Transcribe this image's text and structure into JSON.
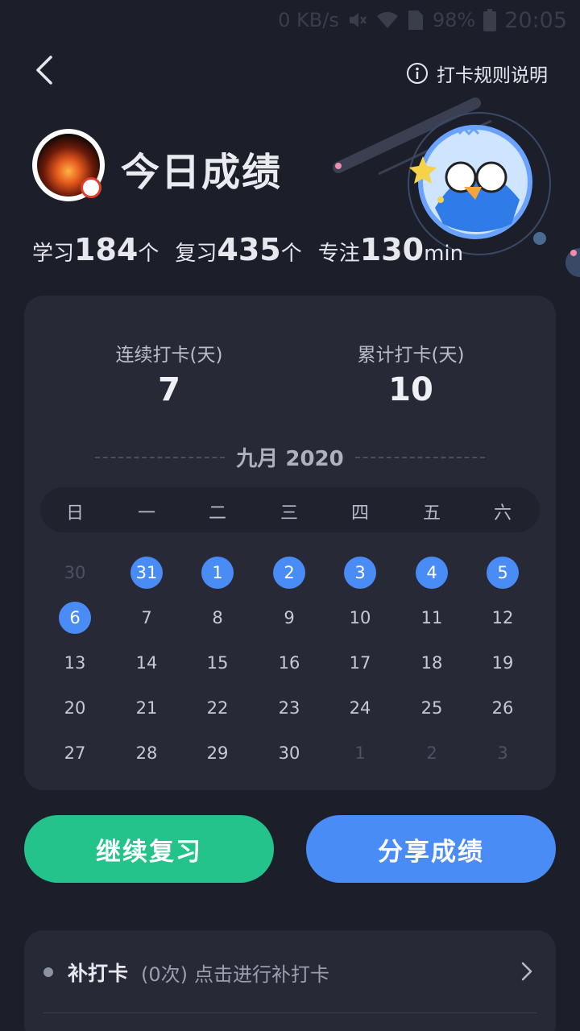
{
  "status_bar": {
    "network_speed": "0 KB/s",
    "battery": "98%",
    "time": "20:05",
    "icons": [
      "mute-icon",
      "wifi-icon",
      "sim-icon",
      "battery-icon"
    ]
  },
  "header": {
    "back_icon": "chevron-left-icon",
    "rules_label": "打卡规则说明",
    "rules_icon": "info-icon"
  },
  "profile": {
    "title": "今日成绩",
    "stats": [
      {
        "label": "学习",
        "value": "184",
        "unit": "个"
      },
      {
        "label": "复习",
        "value": "435",
        "unit": "个"
      },
      {
        "label": "专注",
        "value": "130",
        "unit": "min"
      }
    ]
  },
  "calendar_card": {
    "streak": {
      "label": "连续打卡(天)",
      "value": "7"
    },
    "total": {
      "label": "累计打卡(天)",
      "value": "10"
    },
    "month_label": "九月 2020",
    "weekdays": [
      "日",
      "一",
      "二",
      "三",
      "四",
      "五",
      "六"
    ],
    "weeks": [
      [
        {
          "d": "30",
          "s": "muted"
        },
        {
          "d": "31",
          "s": "checked"
        },
        {
          "d": "1",
          "s": "checked"
        },
        {
          "d": "2",
          "s": "checked"
        },
        {
          "d": "3",
          "s": "checked"
        },
        {
          "d": "4",
          "s": "checked"
        },
        {
          "d": "5",
          "s": "checked"
        }
      ],
      [
        {
          "d": "6",
          "s": "checked"
        },
        {
          "d": "7",
          "s": "normal"
        },
        {
          "d": "8",
          "s": "normal"
        },
        {
          "d": "9",
          "s": "normal"
        },
        {
          "d": "10",
          "s": "normal"
        },
        {
          "d": "11",
          "s": "normal"
        },
        {
          "d": "12",
          "s": "normal"
        }
      ],
      [
        {
          "d": "13",
          "s": "normal"
        },
        {
          "d": "14",
          "s": "normal"
        },
        {
          "d": "15",
          "s": "normal"
        },
        {
          "d": "16",
          "s": "normal"
        },
        {
          "d": "17",
          "s": "normal"
        },
        {
          "d": "18",
          "s": "normal"
        },
        {
          "d": "19",
          "s": "normal"
        }
      ],
      [
        {
          "d": "20",
          "s": "normal"
        },
        {
          "d": "21",
          "s": "normal"
        },
        {
          "d": "22",
          "s": "normal"
        },
        {
          "d": "23",
          "s": "normal"
        },
        {
          "d": "24",
          "s": "normal"
        },
        {
          "d": "25",
          "s": "normal"
        },
        {
          "d": "26",
          "s": "normal"
        }
      ],
      [
        {
          "d": "27",
          "s": "normal"
        },
        {
          "d": "28",
          "s": "normal"
        },
        {
          "d": "29",
          "s": "normal"
        },
        {
          "d": "30",
          "s": "normal"
        },
        {
          "d": "1",
          "s": "muted"
        },
        {
          "d": "2",
          "s": "muted"
        },
        {
          "d": "3",
          "s": "muted"
        }
      ]
    ]
  },
  "buttons": {
    "continue_review": "继续复习",
    "share_results": "分享成绩"
  },
  "makeup": {
    "title": "补打卡",
    "count": "(0次)",
    "hint": "点击进行补打卡",
    "chevron_icon": "chevron-right-icon"
  },
  "colors": {
    "background": "#1c1f2a",
    "card": "#272a36",
    "checked_day": "#4a8cf6",
    "green_button": "#23c38b",
    "blue_button": "#4a8cf6"
  }
}
